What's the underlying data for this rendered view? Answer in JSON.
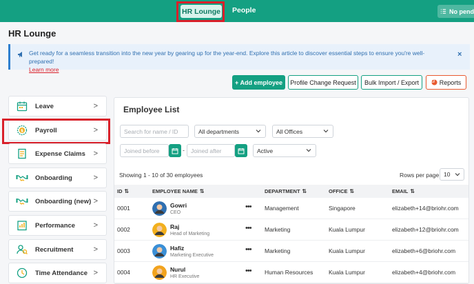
{
  "topbar": {
    "tabs": [
      {
        "label": "HR Lounge",
        "active": true
      },
      {
        "label": "People",
        "active": false
      }
    ],
    "notification": "No pendin"
  },
  "page_title": "HR Lounge",
  "banner": {
    "message": "Get ready for a seamless transition into the new year by gearing up for the year-end. Explore this article to discover essential steps to ensure you're well-prepared!",
    "link": "Learn more",
    "close": "×"
  },
  "actions": {
    "add_employee": "+ Add employee",
    "profile_change": "Profile Change Request",
    "bulk_import": "Bulk Import / Export",
    "reports": "Reports"
  },
  "sidebar": {
    "items": [
      {
        "label": "Leave",
        "icon": "calendar-icon"
      },
      {
        "label": "Payroll",
        "icon": "coin-icon"
      },
      {
        "label": "Expense Claims",
        "icon": "receipt-icon"
      },
      {
        "label": "Onboarding",
        "icon": "handshake-icon"
      },
      {
        "label": "Onboarding (new)",
        "icon": "handshake-icon"
      },
      {
        "label": "Performance",
        "icon": "performance-icon"
      },
      {
        "label": "Recruitment",
        "icon": "recruitment-icon"
      },
      {
        "label": "Time Attendance",
        "icon": "clock-icon"
      }
    ]
  },
  "employee_list": {
    "title": "Employee List",
    "filters": {
      "search_placeholder": "Search for name / ID",
      "departments": "All departments",
      "offices": "All Offices",
      "joined_before_placeholder": "Joined before",
      "separator": "-",
      "joined_after_placeholder": "Joined after",
      "status": "Active"
    },
    "showing": "Showing 1 - 10 of 30 employees",
    "rows_per_page_label": "Rows per page",
    "rows_per_page": "10",
    "columns": [
      "ID",
      "EMPLOYEE NAME",
      "DEPARTMENT",
      "OFFICE",
      "EMAIL"
    ],
    "rows": [
      {
        "id": "0001",
        "name": "Gowri",
        "title": "CEO",
        "department": "Management",
        "office": "Singapore",
        "email": "elizabeth+14@briohr.com",
        "avatar_color": "#2f6fb0"
      },
      {
        "id": "0002",
        "name": "Raj",
        "title": "Head of Marketing",
        "department": "Marketing",
        "office": "Kuala Lumpur",
        "email": "elizabeth+12@briohr.com",
        "avatar_color": "#f2b01e"
      },
      {
        "id": "0003",
        "name": "Hafiz",
        "title": "Marketing Executive",
        "department": "Marketing",
        "office": "Kuala Lumpur",
        "email": "elizabeth+6@briohr.com",
        "avatar_color": "#3a8fd6"
      },
      {
        "id": "0004",
        "name": "Nurul",
        "title": "HR Executive",
        "department": "Human Resources",
        "office": "Kuala Lumpur",
        "email": "elizabeth+4@briohr.com",
        "avatar_color": "#f2a31e"
      }
    ]
  },
  "colors": {
    "brand": "#14a082",
    "highlight": "#d9202a",
    "reports_accent": "#e8592f",
    "banner_text": "#2f6fb0"
  }
}
